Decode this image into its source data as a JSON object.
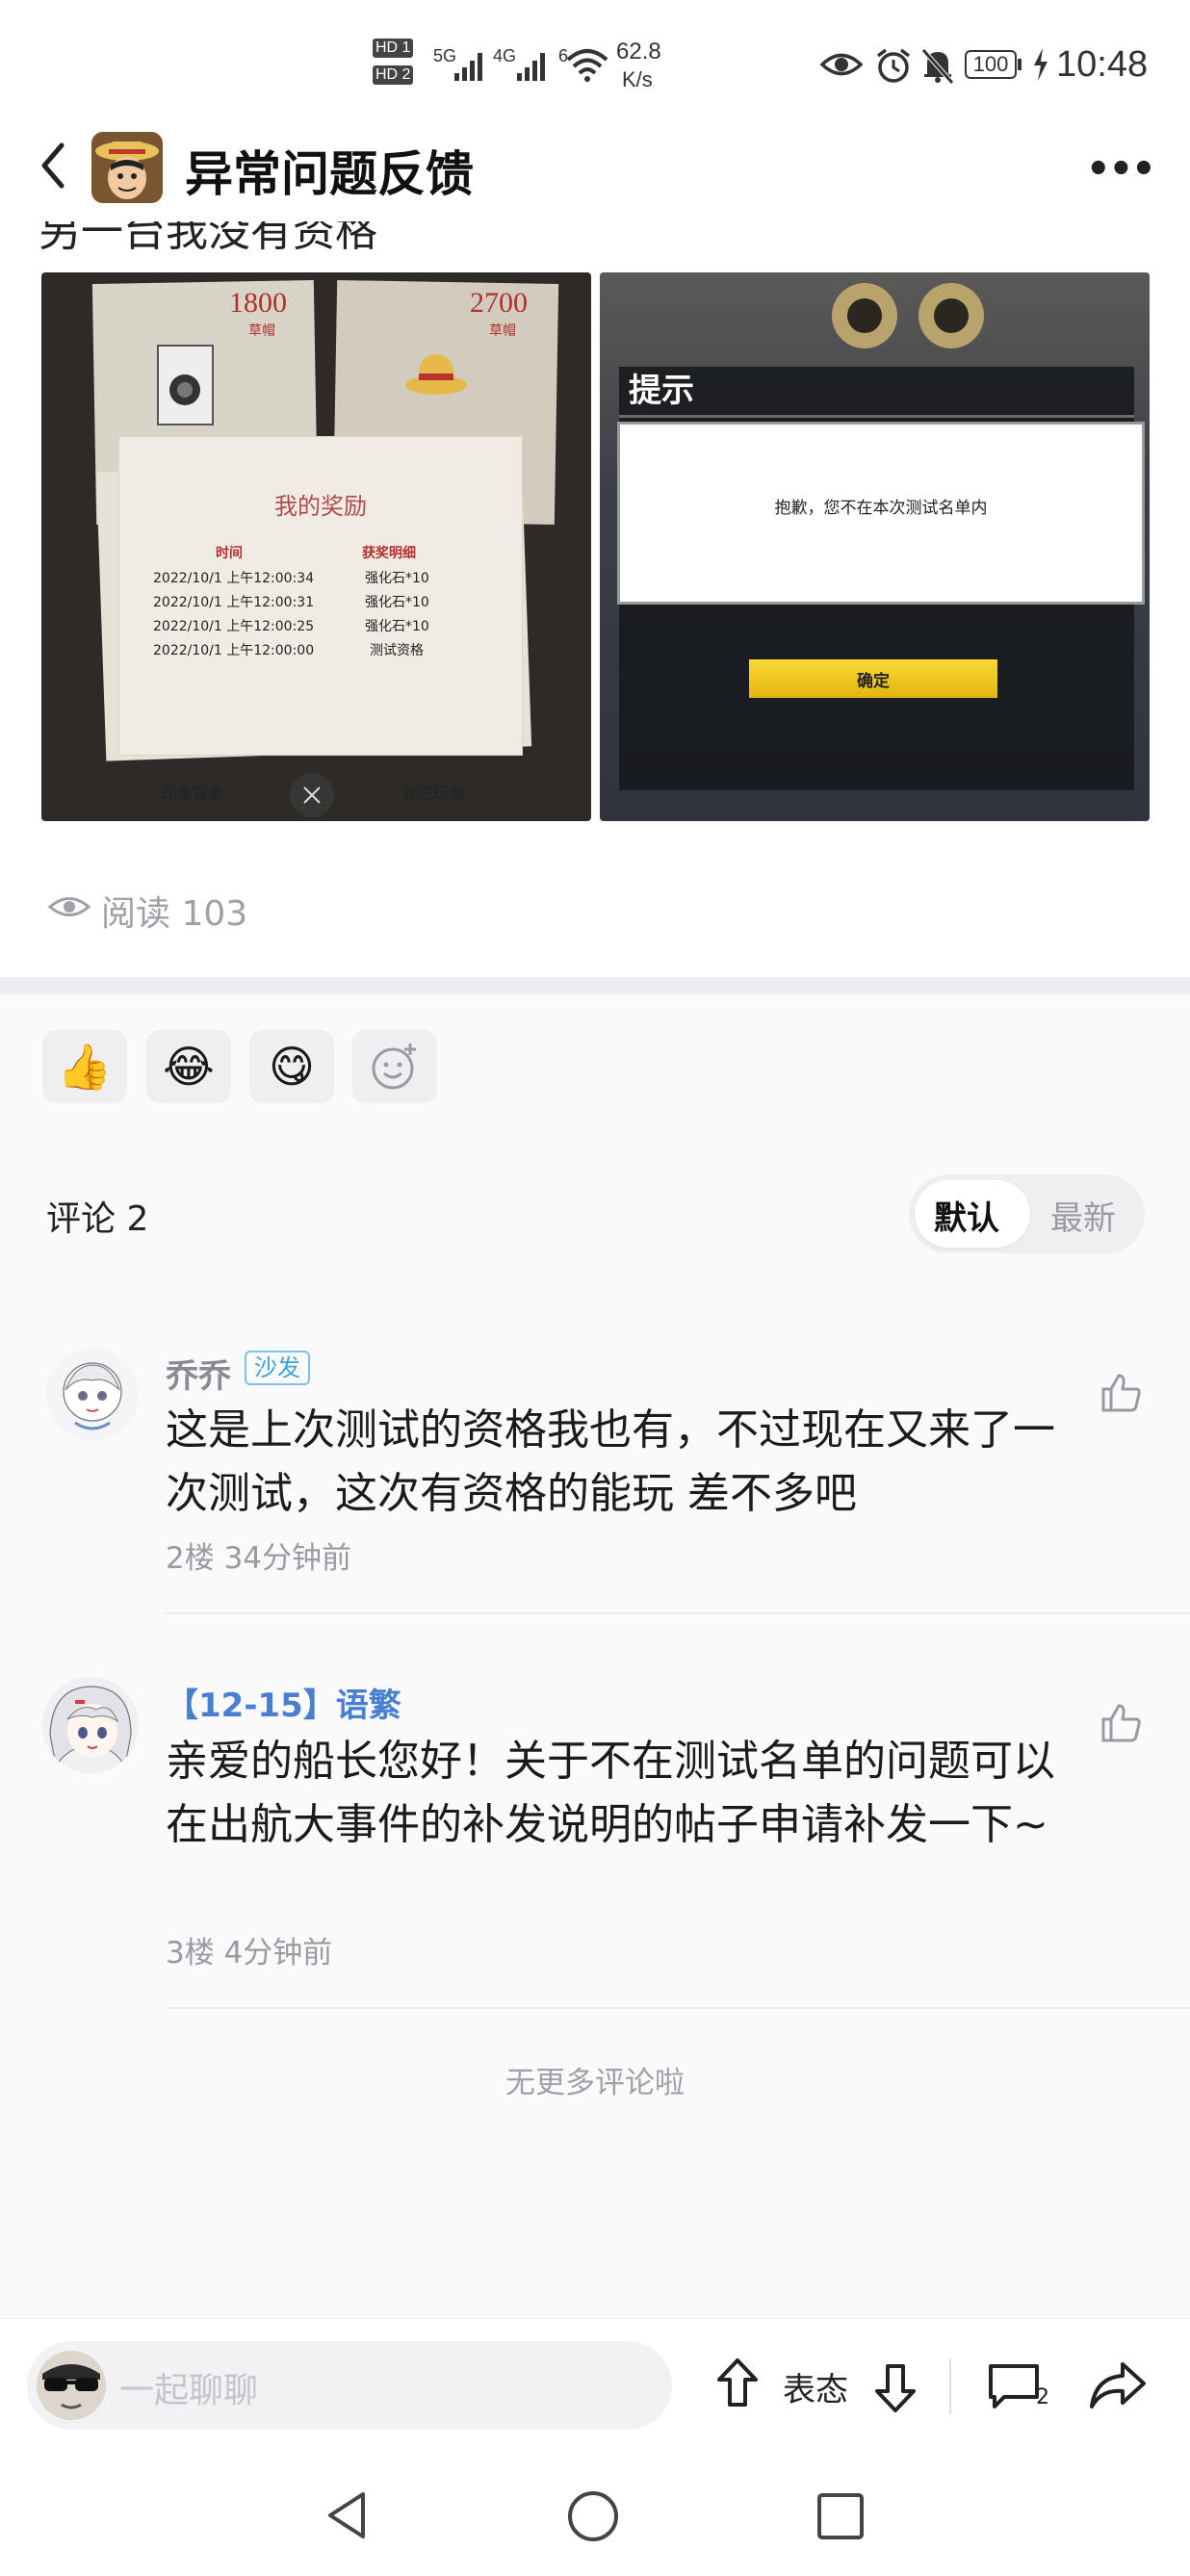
{
  "status_bar": {
    "hd1": "HD 1",
    "hd2": "HD 2",
    "net1": "5G",
    "net2": "4G",
    "wifi_num": "6",
    "speed_value": "62.8",
    "speed_unit": "K/s",
    "battery": "100",
    "time": "10:48"
  },
  "header": {
    "title": "异常问题反馈",
    "more": "•••"
  },
  "post": {
    "clipped_text": "另一台我没有资格",
    "read_count_label": "阅读 103",
    "image_left": {
      "count_left": "1800",
      "count_left_sub": "草帽",
      "count_right": "2700",
      "count_right_sub": "草帽",
      "panel_title": "我的奖励",
      "col_time": "时间",
      "col_detail": "获奖明细",
      "rows": [
        {
          "time": "2022/10/1 上午12:00:34",
          "detail": "强化石*10"
        },
        {
          "time": "2022/10/1 上午12:00:31",
          "detail": "强化石*10"
        },
        {
          "time": "2022/10/1 上午12:00:25",
          "detail": "强化石*10"
        },
        {
          "time": "2022/10/1 上午12:00:00",
          "detail": "测试资格"
        }
      ],
      "bottom_left": "印章盲盒",
      "bottom_right": "乔巴玩偶"
    },
    "image_right": {
      "dialog_title": "提示",
      "dialog_message": "抱歉，您不在本次测试名单内",
      "confirm": "确定"
    }
  },
  "reactions": [
    {
      "icon": "thumbs-up-emoji",
      "glyph": "👍"
    },
    {
      "icon": "laughing-crying-emoji",
      "glyph": "😂"
    },
    {
      "icon": "drooling-emoji",
      "glyph": "😋"
    },
    {
      "icon": "add-emoji",
      "glyph": "☺"
    }
  ],
  "comments_header": {
    "label": "评论 2",
    "sort_default": "默认",
    "sort_latest": "最新"
  },
  "comments": [
    {
      "name": "乔乔",
      "badge": "沙发",
      "text": "这是上次测试的资格我也有，不过现在又来了一次测试，这次有资格的能玩 差不多吧",
      "meta": "2楼 34分钟前"
    },
    {
      "name": "【12-15】语繁",
      "text": "亲爱的船长您好！关于不在测试名单的问题可以在出航大事件的补发说明的帖子申请补发一下~",
      "meta": "3楼 4分钟前"
    }
  ],
  "end_text": "无更多评论啦",
  "bottom_bar": {
    "input_placeholder": "一起聊聊",
    "attitude": "表态",
    "comment_count": "2"
  },
  "colors": {
    "accent_blue": "#4a7fd0",
    "badge_blue": "#3aa3d4",
    "confirm_yellow": "#f1cd1d"
  }
}
